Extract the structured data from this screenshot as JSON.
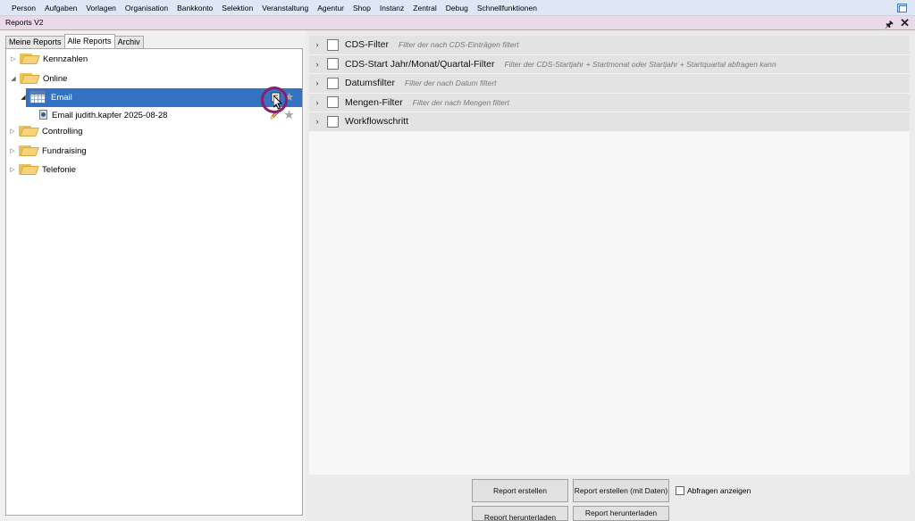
{
  "menu": {
    "items": [
      "Person",
      "Aufgaben",
      "Vorlagen",
      "Organisation",
      "Bankkonto",
      "Selektion",
      "Veranstaltung",
      "Agentur",
      "Shop",
      "Instanz",
      "Zentral",
      "Debug",
      "Schnellfunktionen"
    ],
    "app_icon": "window-icon"
  },
  "window": {
    "title": "Reports V2",
    "pin_icon": "pin-icon",
    "close_icon": "close-icon"
  },
  "tabs": [
    {
      "label": "Meine Reports",
      "active": false
    },
    {
      "label": "Alle Reports",
      "active": true
    },
    {
      "label": "Archiv",
      "active": false
    }
  ],
  "tree": {
    "nodes": [
      {
        "label": "Kennzahlen",
        "icon": "folder-icon",
        "expanded": false
      },
      {
        "label": "Online",
        "icon": "folder-icon",
        "expanded": true
      },
      {
        "label": "Email",
        "icon": "table-icon",
        "expanded": true,
        "selected": true
      },
      {
        "label": "Email judith.kapfer 2025-08-28",
        "icon": "report-user-icon"
      },
      {
        "label": "Controlling",
        "icon": "folder-icon",
        "expanded": false
      },
      {
        "label": "Fundraising",
        "icon": "folder-icon",
        "expanded": false
      },
      {
        "label": "Telefonie",
        "icon": "folder-icon",
        "expanded": false
      }
    ],
    "row_icons": [
      "edit-icon",
      "star-icon"
    ]
  },
  "filters": [
    {
      "name": "CDS-Filter",
      "desc": "Filter der nach CDS-Einträgen filtert",
      "checked": false
    },
    {
      "name": "CDS-Start Jahr/Monat/Quartal-Filter",
      "desc": "Filter der CDS-Startjahr + Startmonat oder Startjahr + Startquartal abfragen kann",
      "checked": false
    },
    {
      "name": "Datumsfilter",
      "desc": "Filter der nach Datum filtert",
      "checked": false
    },
    {
      "name": "Mengen-Filter",
      "desc": "Filter der nach Mengen filtert",
      "checked": false
    },
    {
      "name": "Workflowschritt",
      "desc": "",
      "checked": false
    }
  ],
  "buttons": {
    "create": "Report erstellen",
    "create_with_data": "Report erstellen (mit Daten)",
    "show_queries": "Abfragen anzeigen",
    "download": "Report herunterladen",
    "download_with_data": "Report herunterladen\nmit Daten"
  },
  "colors": {
    "selection": "#3472c4",
    "menubar": "#dde7f5",
    "titlebar": "#e9d9e9",
    "cursor_ring": "#8a1d6e"
  }
}
